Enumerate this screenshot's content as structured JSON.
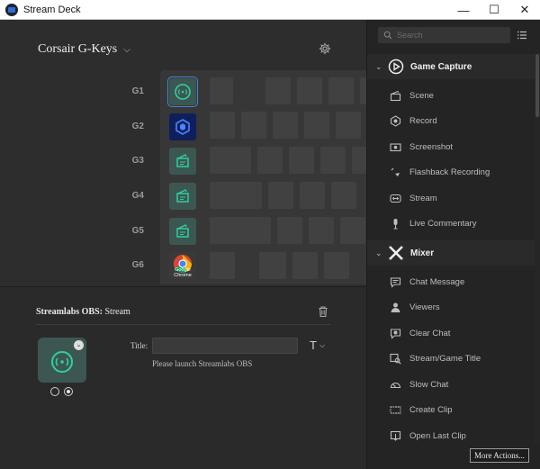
{
  "window": {
    "title": "Stream Deck",
    "minimize_glyph": "—",
    "maximize_glyph": "☐",
    "close_glyph": "✕"
  },
  "profile": {
    "name": "Corsair G-Keys",
    "chevron": "⌵"
  },
  "gkeys": [
    {
      "label": "G1",
      "action_icon": "streamlabs-icon",
      "selected": true
    },
    {
      "label": "G2",
      "action_icon": "hexagon-cube-icon",
      "selected": false
    },
    {
      "label": "G3",
      "action_icon": "scene-icon",
      "selected": false
    },
    {
      "label": "G4",
      "action_icon": "scene-icon",
      "selected": false
    },
    {
      "label": "G5",
      "action_icon": "scene-icon",
      "selected": false
    },
    {
      "label": "G6",
      "action_icon": "chrome-icon",
      "key_text": "Google Chrome",
      "selected": false
    }
  ],
  "inspector": {
    "plugin": "Streamlabs OBS:",
    "action": "Stream",
    "title_label": "Title:",
    "title_value": "",
    "text_style_glyph": "T",
    "text_style_chevron": "⌵",
    "message": "Please launch Streamlabs OBS",
    "preview_chevron": "⌄"
  },
  "sidebar": {
    "search_placeholder": "Search",
    "categories": [
      {
        "label": "Game Capture",
        "icon": "play-circle-icon",
        "caret": "⌄",
        "actions": [
          {
            "label": "Scene",
            "icon": "scene-icon"
          },
          {
            "label": "Record",
            "icon": "record-icon"
          },
          {
            "label": "Screenshot",
            "icon": "screenshot-icon"
          },
          {
            "label": "Flashback Recording",
            "icon": "flashback-icon"
          },
          {
            "label": "Stream",
            "icon": "stream-icon"
          },
          {
            "label": "Live Commentary",
            "icon": "microphone-icon"
          }
        ]
      },
      {
        "label": "Mixer",
        "icon": "mixer-icon",
        "caret": "⌄",
        "actions": [
          {
            "label": "Chat Message",
            "icon": "chat-message-icon"
          },
          {
            "label": "Viewers",
            "icon": "viewers-icon"
          },
          {
            "label": "Clear Chat",
            "icon": "clear-chat-icon"
          },
          {
            "label": "Stream/Game Title",
            "icon": "stream-title-icon"
          },
          {
            "label": "Slow Chat",
            "icon": "slow-chat-icon"
          },
          {
            "label": "Create Clip",
            "icon": "create-clip-icon"
          },
          {
            "label": "Open Last Clip",
            "icon": "open-clip-icon"
          }
        ]
      }
    ],
    "more_actions": "More Actions..."
  },
  "colors": {
    "background": "#2d2d2d",
    "sidebar": "#242424",
    "key_green": "#3c5751",
    "accent_teal": "#2fcfa0",
    "selected_outline": "#3f87d6"
  }
}
